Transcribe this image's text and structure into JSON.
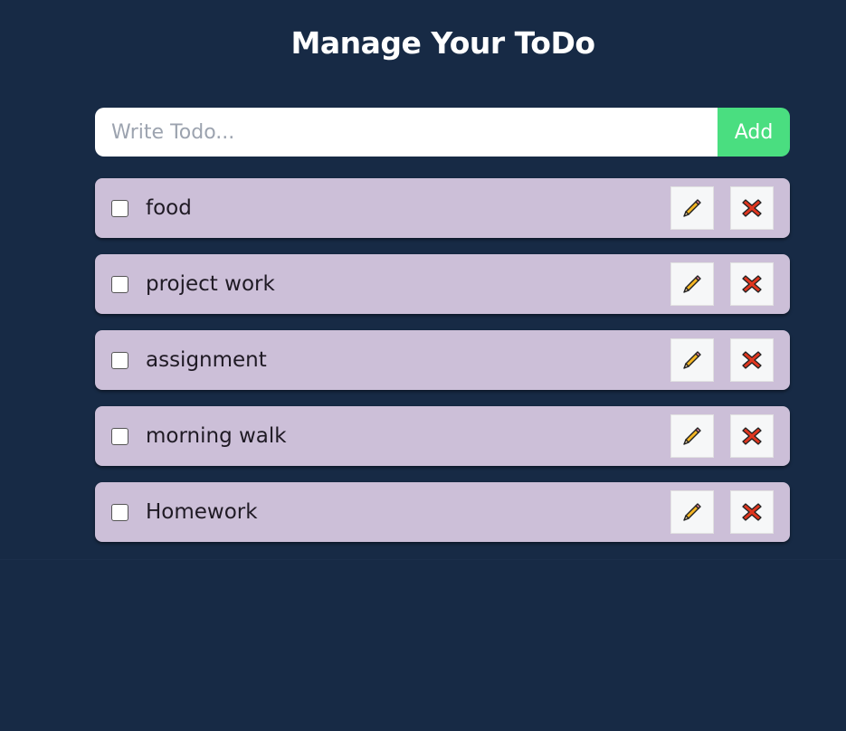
{
  "header": {
    "title": "Manage Your ToDo"
  },
  "input": {
    "placeholder": "Write Todo...",
    "value": ""
  },
  "add_button": {
    "label": "Add"
  },
  "todos": [
    {
      "text": "food",
      "checked": false
    },
    {
      "text": "project work",
      "checked": false
    },
    {
      "text": "assignment",
      "checked": false
    },
    {
      "text": "morning walk",
      "checked": false
    },
    {
      "text": "Homework",
      "checked": false
    }
  ],
  "icons": {
    "edit": "pencil-icon",
    "delete": "close-x-icon"
  },
  "colors": {
    "background": "#172a45",
    "item_background": "#ccbfd8",
    "add_button": "#4ade80",
    "pencil": "#f5b624",
    "delete": "#e0361f"
  }
}
